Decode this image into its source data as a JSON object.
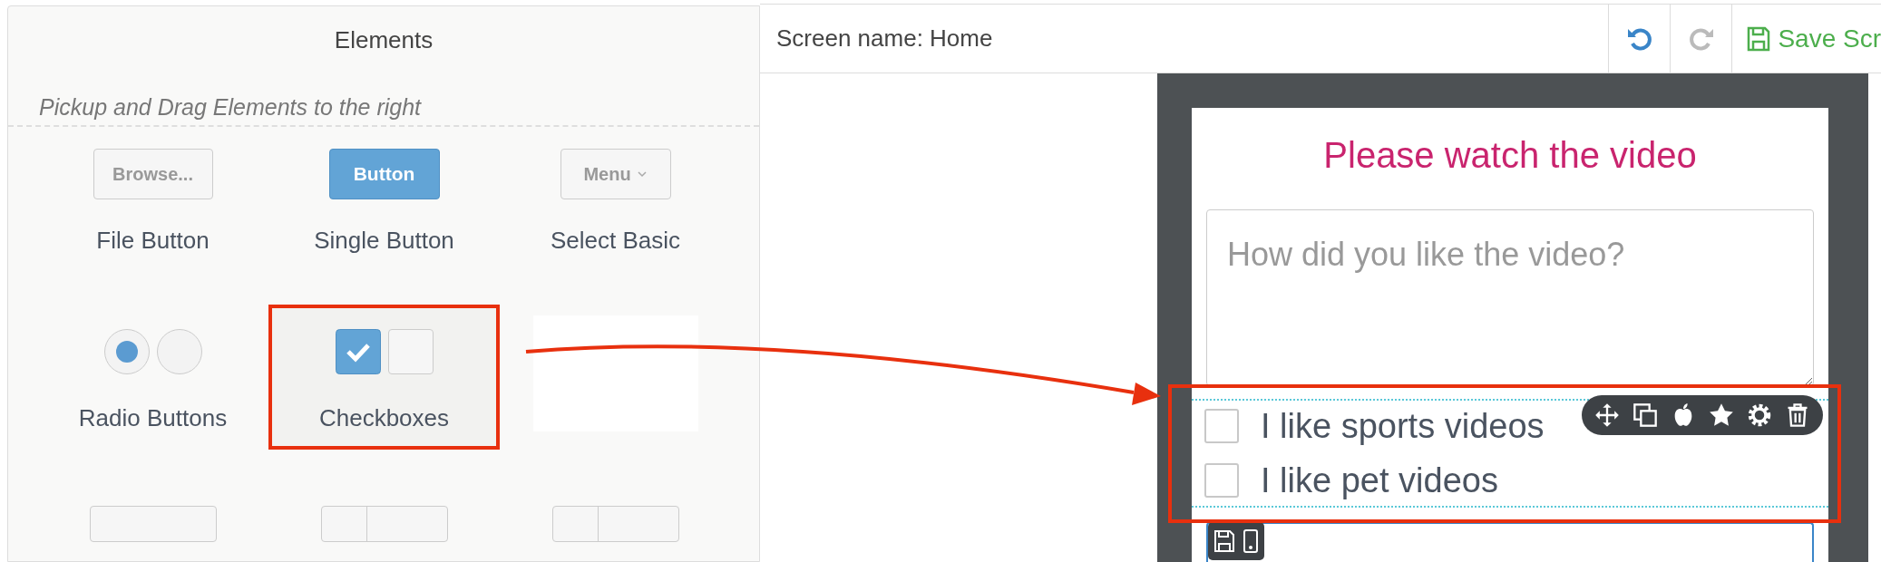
{
  "panel": {
    "title": "Elements",
    "hint": "Pickup and Drag Elements to the right"
  },
  "elements": [
    {
      "kind": "file",
      "preview": "Browse...",
      "label": "File Button",
      "selected": false
    },
    {
      "kind": "button",
      "preview": "Button",
      "label": "Single Button",
      "selected": false
    },
    {
      "kind": "select",
      "preview": "Menu",
      "label": "Select Basic",
      "selected": false
    },
    {
      "kind": "radio",
      "label": "Radio Buttons",
      "selected": false
    },
    {
      "kind": "checkbox",
      "label": "Checkboxes",
      "selected": true
    },
    {
      "kind": "blank",
      "selected": false
    },
    {
      "kind": "stub",
      "selected": false
    },
    {
      "kind": "stub-prepend",
      "selected": false
    },
    {
      "kind": "stub-prepend",
      "selected": false
    }
  ],
  "toolbar": {
    "screen_name": "Screen name: Home",
    "undo": {
      "disabled": false
    },
    "redo": {
      "disabled": true
    },
    "save": "Save Scr"
  },
  "canvas": {
    "heading": "Please watch the video",
    "textarea": {
      "placeholder": "How did you like the video?"
    },
    "checkboxes": [
      {
        "label": "I like sports videos",
        "checked": false
      },
      {
        "label": "I like pet videos",
        "checked": false
      }
    ]
  }
}
